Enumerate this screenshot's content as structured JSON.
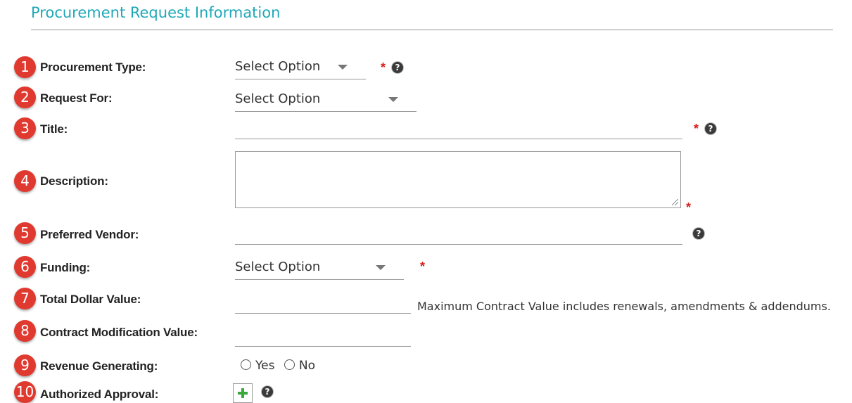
{
  "section": {
    "title": "Procurement Request Information"
  },
  "fields": [
    {
      "num": "1",
      "label": "Procurement Type:",
      "value": "Select Option",
      "required": "*"
    },
    {
      "num": "2",
      "label": "Request For:",
      "value": "Select Option"
    },
    {
      "num": "3",
      "label": "Title:",
      "required": "*"
    },
    {
      "num": "4",
      "label": "Description:",
      "required": "*"
    },
    {
      "num": "5",
      "label": "Preferred Vendor:"
    },
    {
      "num": "6",
      "label": "Funding:",
      "value": "Select Option",
      "required": "*"
    },
    {
      "num": "7",
      "label": "Total Dollar Value:",
      "note": "Maximum Contract Value includes renewals, amendments & addendums."
    },
    {
      "num": "8",
      "label": "Contract Modification Value:"
    },
    {
      "num": "9",
      "label": "Revenue Generating:",
      "options": [
        "Yes",
        "No"
      ]
    },
    {
      "num": "10",
      "label": "Authorized Approval:"
    }
  ],
  "help_glyph": "?",
  "colors": {
    "accent": "#1fa8b8",
    "badge": "#e03a30",
    "required": "#d61f1f",
    "add": "#3aa83a"
  },
  "icons": {
    "dropdown": "chevron-down-icon",
    "help": "help-icon",
    "add": "plus-icon"
  }
}
